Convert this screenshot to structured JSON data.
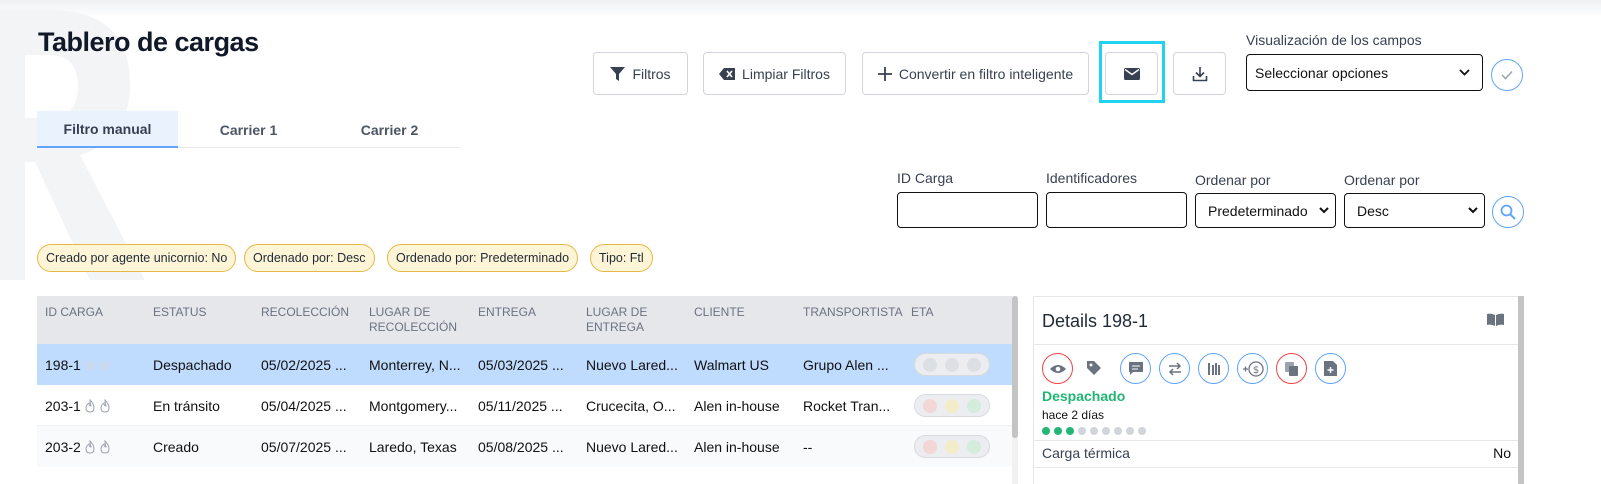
{
  "page": {
    "title": "Tablero de cargas"
  },
  "toolbar": {
    "filters_label": "Filtros",
    "clear_filters_label": "Limpiar Filtros",
    "smart_filter_label": "Convertir en filtro inteligente"
  },
  "visualization": {
    "label": "Visualización de los campos",
    "selected": "Seleccionar opciones"
  },
  "tabs": [
    {
      "label": "Filtro manual",
      "active": true
    },
    {
      "label": "Carrier 1",
      "active": false
    },
    {
      "label": "Carrier 2",
      "active": false
    }
  ],
  "filters": {
    "id_carga_label": "ID Carga",
    "identificadores_label": "Identificadores",
    "order1_label": "Ordenar por",
    "order1_value": "Predeterminado",
    "order2_label": "Ordenar por",
    "order2_value": "Desc"
  },
  "chips": [
    "Creado por agente unicornio: No",
    "Ordenado por: Desc",
    "Ordenado por: Predeterminado",
    "Tipo: Ftl"
  ],
  "table": {
    "headers": [
      "ID CARGA",
      "ESTATUS",
      "RECOLECCIÓN",
      "LUGAR DE RECOLECCIÓN",
      "ENTREGA",
      "LUGAR DE ENTREGA",
      "CLIENTE",
      "TRANSPORTISTA",
      "ETA"
    ],
    "rows": [
      {
        "id": "198-1",
        "status": "Despachado",
        "pickup": "05/02/2025 ...",
        "pickup_place": "Monterrey, N...",
        "delivery": "05/03/2025 ...",
        "delivery_place": "Nuevo Lared...",
        "client": "Walmart US",
        "carrier": "Grupo Alen ...",
        "selected": true
      },
      {
        "id": "203-1",
        "status": "En tránsito",
        "pickup": "05/04/2025 ...",
        "pickup_place": "Montgomery...",
        "delivery": "05/11/2025 ...",
        "delivery_place": "Crucecita, O...",
        "client": "Alen in-house",
        "carrier": "Rocket Tran...",
        "selected": false
      },
      {
        "id": "203-2",
        "status": "Creado",
        "pickup": "05/07/2025 ...",
        "pickup_place": "Laredo, Texas",
        "delivery": "05/08/2025 ...",
        "delivery_place": "Nuevo Lared...",
        "client": "Alen in-house",
        "carrier": "--",
        "selected": false
      }
    ]
  },
  "details": {
    "title": "Details 198-1",
    "status": "Despachado",
    "time": "hace 2 días",
    "progress": {
      "done": 3,
      "total": 9
    },
    "field_label": "Carga térmica",
    "field_value": "No"
  },
  "colors": {
    "accent": "#60a5fa",
    "highlight": "#22d3ee",
    "success": "#22b573",
    "chip_bg": "#fdf5d6",
    "chip_border": "#e5b84a",
    "selected_row": "#bfdbfe"
  }
}
